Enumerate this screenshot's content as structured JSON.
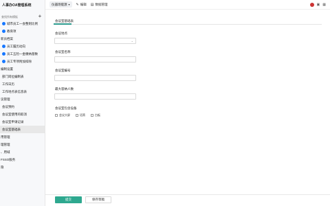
{
  "app": {
    "title": "人事办OA管理系统"
  },
  "sidebar": {
    "search_placeholder": "查找所有模板",
    "add_label": "+",
    "items": [
      {
        "label": "城市员工一会整则比例",
        "kind": "sub"
      },
      {
        "label": "教育项",
        "kind": "sub"
      },
      {
        "label": "新员档案",
        "kind": "grp"
      },
      {
        "label": "员工履历动向",
        "kind": "sub"
      },
      {
        "label": "员工五险一金缴纳基数",
        "kind": "sub"
      },
      {
        "label": "员工专项附加扣除",
        "kind": "sub"
      },
      {
        "label": "编制设置",
        "kind": "grp"
      },
      {
        "label": "部门岗位编制表",
        "kind": "ind"
      },
      {
        "label": "工作日历",
        "kind": "ind"
      },
      {
        "label": "工作地点表信息表",
        "kind": "ind"
      },
      {
        "label": "议管理",
        "kind": "grp"
      },
      {
        "label": "会议预约",
        "kind": "ind"
      },
      {
        "label": "会议室使用的取消",
        "kind": "ind"
      },
      {
        "label": "会议室申请记录",
        "kind": "ind"
      },
      {
        "label": "会议室基础表",
        "kind": "ind",
        "active": true
      },
      {
        "label": "用管理",
        "kind": "grp"
      },
      {
        "label": "理管理",
        "kind": "grp"
      },
      {
        "label": "、用域",
        "kind": "grp"
      },
      {
        "label": "FSSO服务",
        "kind": "grp"
      },
      {
        "label": "隐",
        "kind": "grp"
      }
    ]
  },
  "topbar": {
    "breadcrumb": "仪器场能源",
    "edit_label": "编辑",
    "data_label": "数据管理"
  },
  "form": {
    "tab_label": "会议室基础表",
    "location_label": "会议地点",
    "name_label": "会议室名称",
    "code_label": "会议室编号",
    "capacity_label": "最大容纳人数",
    "equipment_label": "会议室包含设备",
    "equipment_options": [
      "会议大屏",
      "话筒",
      "白板"
    ],
    "submit_label": "提交",
    "draft_label": "保存草稿"
  },
  "colors": {
    "accent": "#2ea88f",
    "nav_dot": "#1677ff"
  }
}
